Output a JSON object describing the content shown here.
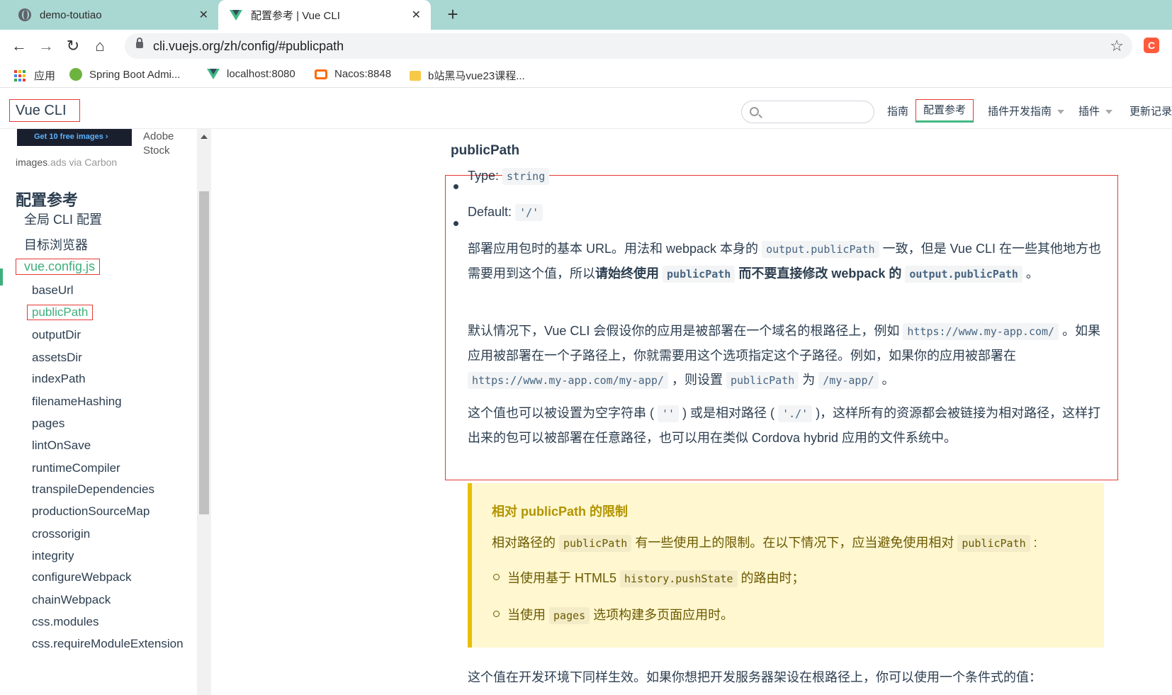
{
  "browser": {
    "tabs": [
      {
        "title": "demo-toutiao",
        "close": "✕"
      },
      {
        "title": "配置参考 | Vue CLI",
        "close": "✕"
      }
    ],
    "new_tab": "+",
    "url": "cli.vuejs.org/zh/config/#publicpath",
    "bookmarks": [
      {
        "label": "应用"
      },
      {
        "label": "Spring Boot Admi..."
      },
      {
        "label": "localhost:8080"
      },
      {
        "label": "Nacos:8848"
      },
      {
        "label": "b站黑马vue23课程..."
      }
    ],
    "ext_label": "C"
  },
  "header": {
    "site_title": "Vue CLI",
    "search_placeholder": "",
    "nav": [
      {
        "label": "指南"
      },
      {
        "label": "配置参考"
      },
      {
        "label": "插件开发指南"
      },
      {
        "label": "插件"
      },
      {
        "label": "更新记录"
      }
    ]
  },
  "sidebar": {
    "ad": {
      "image_text": "Get 10 free images ›",
      "text": "Adobe Stock",
      "via_brand": "images",
      "via_rest": ".ads via Carbon"
    },
    "heading": "配置参考",
    "level1": [
      "全局 CLI 配置",
      "目标浏览器",
      "vue.config.js"
    ],
    "level2": [
      "baseUrl",
      "publicPath",
      "outputDir",
      "assetsDir",
      "indexPath",
      "filenameHashing",
      "pages",
      "lintOnSave",
      "runtimeCompiler",
      "transpileDependencies",
      "productionSourceMap",
      "crossorigin",
      "integrity",
      "configureWebpack",
      "chainWebpack",
      "css.modules",
      "css.requireModuleExtension"
    ]
  },
  "content": {
    "heading": "publicPath",
    "type_label": "Type:",
    "type_value": "string",
    "default_label": "Default:",
    "default_value": "'/'",
    "p1": {
      "t1": "部署应用包时的基本 URL。用法和 webpack 本身的 ",
      "c1": "output.publicPath",
      "t2": " 一致，但是 Vue CLI 在一些其他地方也需要用到这个值，所以",
      "b1": "请始终使用 ",
      "c2": "publicPath",
      "b2": " 而不要直接修改 webpack 的 ",
      "c3": "output.publicPath",
      "t3": " 。"
    },
    "p2": {
      "t1": "默认情况下，Vue CLI 会假设你的应用是被部署在一个域名的根路径上，例如 ",
      "c1": "https://www.my-app.com/",
      "t2": " 。如果应用被部署在一个子路径上，你就需要用这个选项指定这个子路径。例如，如果你的应用被部署在 ",
      "c2": "https://www.my-app.com/my-app/",
      "t3": " ，则设置 ",
      "c3": "publicPath",
      "t4": " 为 ",
      "c4": "/my-app/",
      "t5": " 。"
    },
    "p3": {
      "t1": "这个值也可以被设置为空字符串 ( ",
      "c1": "''",
      "t2": " ) 或是相对路径 ( ",
      "c2": "'./'",
      "t3": " )，这样所有的资源都会被链接为相对路径，这样打出来的包可以被部署在任意路径，也可以用在类似 Cordova hybrid 应用的文件系统中。"
    },
    "tip": {
      "title": "相对 publicPath 的限制",
      "t1": "相对路径的 ",
      "c1": "publicPath",
      "t2": " 有一些使用上的限制。在以下情况下，应当避免使用相对 ",
      "c2": "publicPath",
      "t3": " :",
      "li1_t1": "当使用基于 HTML5 ",
      "li1_c": "history.pushState",
      "li1_t2": " 的路由时；",
      "li2_t1": "当使用 ",
      "li2_c": "pages",
      "li2_t2": " 选项构建多页面应用时。"
    },
    "bottom": "这个值在开发环境下同样生效。如果你想把开发服务器架设在根路径上，你可以使用一个条件式的值："
  }
}
